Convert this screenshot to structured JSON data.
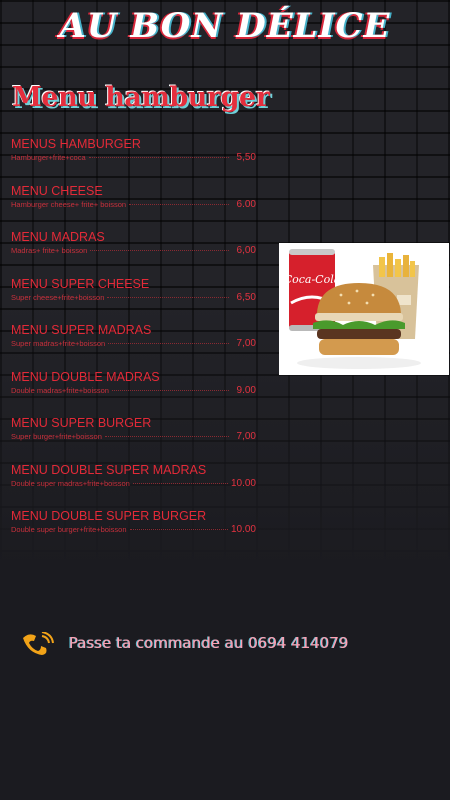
{
  "header": {
    "title": "AU BON DÉLICE"
  },
  "section": {
    "title": "Menu hamburger"
  },
  "menu": [
    {
      "name": "MENUS HAMBURGER",
      "desc": "Hamburger+frite+coca",
      "price": "5,50"
    },
    {
      "name": "MENU CHEESE",
      "desc": "Hamburger cheese+ frite+ boisson",
      "price": "6.00"
    },
    {
      "name": "MENU MADRAS",
      "desc": "Madras+ frite+ boisson",
      "price": "6,00"
    },
    {
      "name": "MENU SUPER CHEESE",
      "desc": "Super cheese+frite+boisson",
      "price": "6,50"
    },
    {
      "name": "MENU SUPER MADRAS",
      "desc": "Super madras+frite+boisson",
      "price": "7,00"
    },
    {
      "name": "MENU DOUBLE MADRAS",
      "desc": "Double madras+frite+boisson",
      "price": "9.00"
    },
    {
      "name": "MENU SUPER BURGER",
      "desc": "Super burger+frite+boisson",
      "price": "7,00"
    },
    {
      "name": "MENU DOUBLE SUPER MADRAS",
      "desc": "Double super madras+frite+boisson",
      "price": "10.00"
    },
    {
      "name": "MENU DOUBLE SUPER BURGER",
      "desc": "Double super burger+frite+boisson",
      "price": "10.00"
    }
  ],
  "photo": {
    "can_label": "Coca-Cola"
  },
  "contact": {
    "text": "Passe ta commande au 0694 414079",
    "icon": "phone-icon"
  },
  "colors": {
    "accent": "#e32a38",
    "background": "#1b1b20"
  }
}
